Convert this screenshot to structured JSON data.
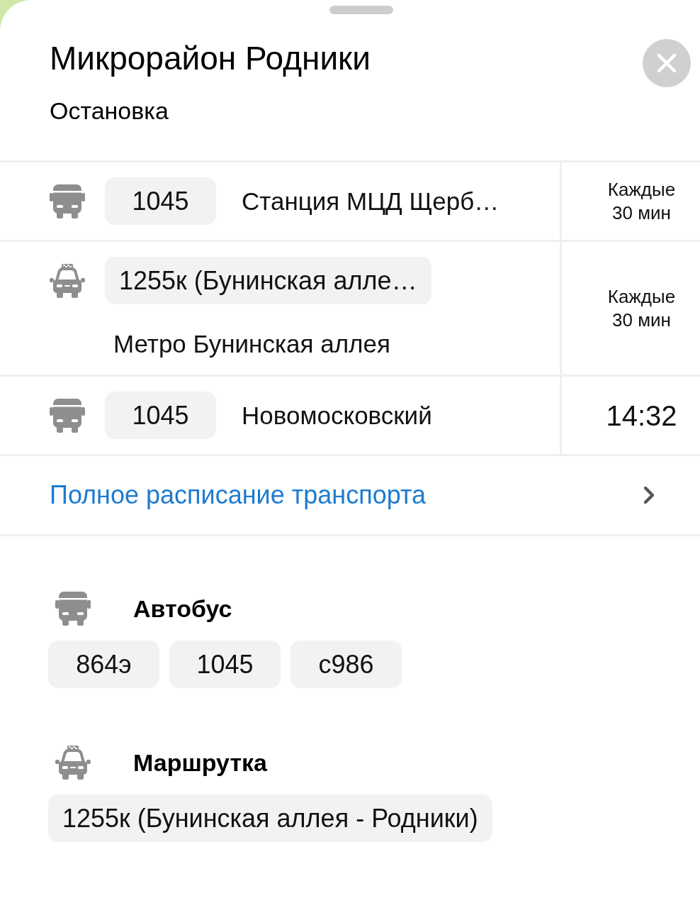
{
  "sheet": {
    "title": "Микрорайон Родники",
    "subtitle": "Остановка"
  },
  "departures": [
    {
      "kind": "bus",
      "route": "1045",
      "destination": "Станция МЦД Щерб…",
      "time": "Каждые 30 мин"
    },
    {
      "kind": "minibus",
      "route": "1255к (Бунинская алле…",
      "destination": "Метро Бунинская аллея",
      "time": "Каждые 30 мин"
    },
    {
      "kind": "bus",
      "route": "1045",
      "destination": "Новомосковский",
      "time": "14:32"
    }
  ],
  "schedule_link": {
    "label": "Полное расписание транспорта"
  },
  "route_groups": [
    {
      "kind": "bus",
      "label": "Автобус",
      "routes": [
        "864э",
        "1045",
        "с986"
      ]
    },
    {
      "kind": "minibus",
      "label": "Маршрутка",
      "routes": [
        "1255к (Бунинская аллея - Родники)"
      ]
    }
  ]
}
